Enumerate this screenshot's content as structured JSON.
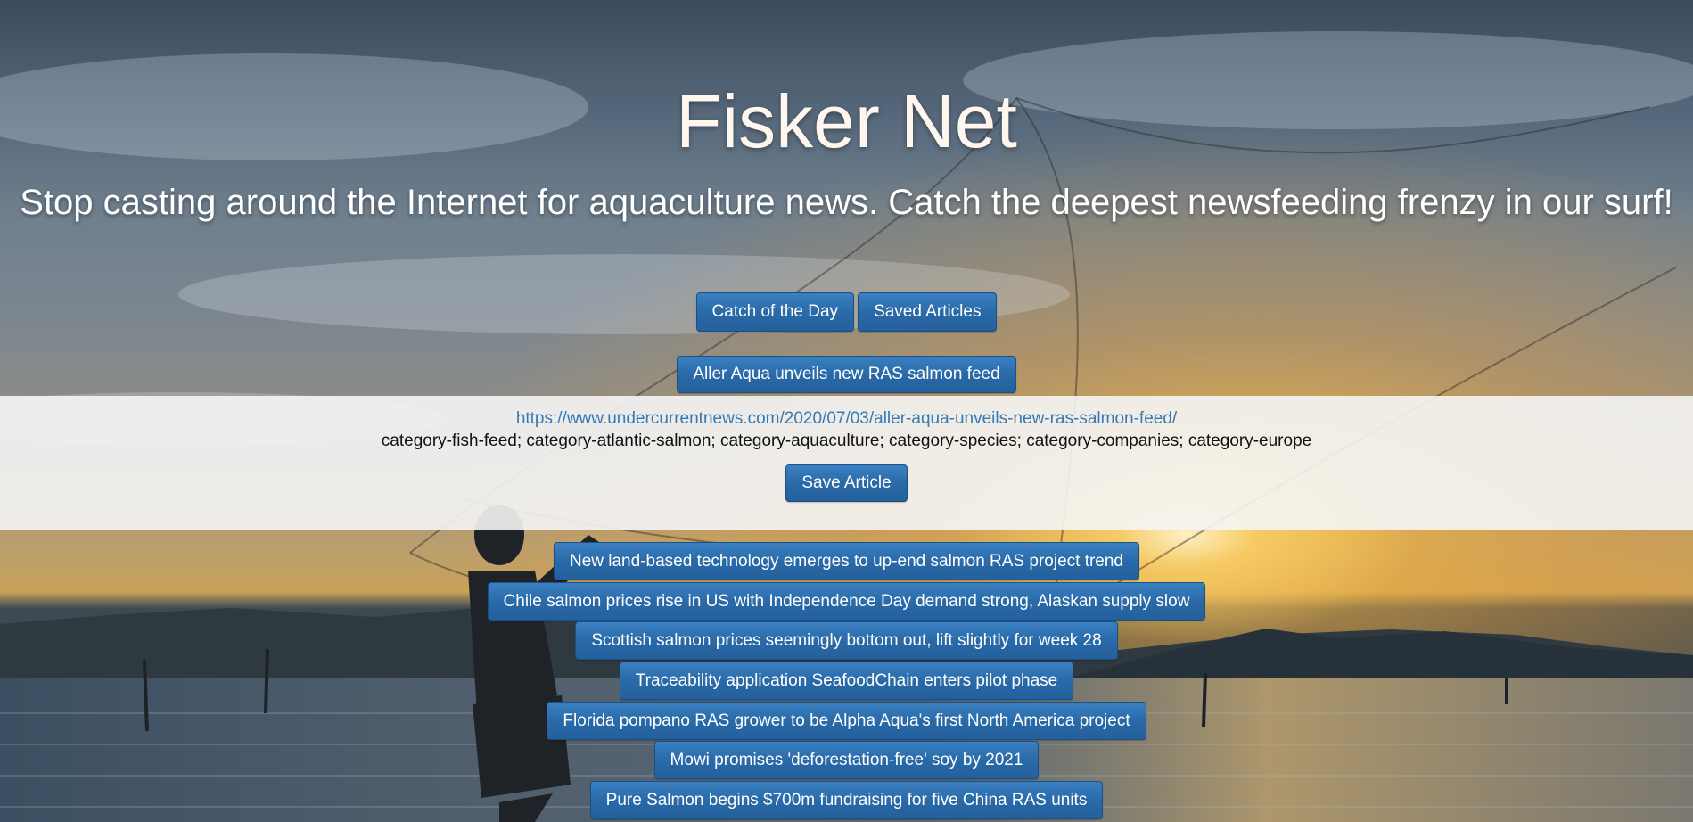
{
  "hero": {
    "title": "Fisker Net",
    "tagline": "Stop casting around the Internet for aquaculture news. Catch the deepest newsfeeding frenzy in our surf!"
  },
  "nav": {
    "catch_of_the_day_label": "Catch of the Day",
    "saved_articles_label": "Saved Articles"
  },
  "featured": {
    "title": "Aller Aqua unveils new RAS salmon feed",
    "url": "https://www.undercurrentnews.com/2020/07/03/aller-aqua-unveils-new-ras-salmon-feed/",
    "categories": "category-fish-feed; category-atlantic-salmon; category-aquaculture; category-species; category-companies; category-europe",
    "save_label": "Save Article"
  },
  "articles": [
    "New land-based technology emerges to up-end salmon RAS project trend",
    "Chile salmon prices rise in US with Independence Day demand strong, Alaskan supply slow",
    "Scottish salmon prices seemingly bottom out, lift slightly for week 28",
    "Traceability application SeafoodChain enters pilot phase",
    "Florida pompano RAS grower to be Alpha Aqua's first North America project",
    "Mowi promises 'deforestation-free' soy by 2021",
    "Pure Salmon begins $700m fundraising for five China RAS units"
  ],
  "colors": {
    "button": "#2a6aa8",
    "link": "#337ab7",
    "panel": "#f5f5f5"
  }
}
